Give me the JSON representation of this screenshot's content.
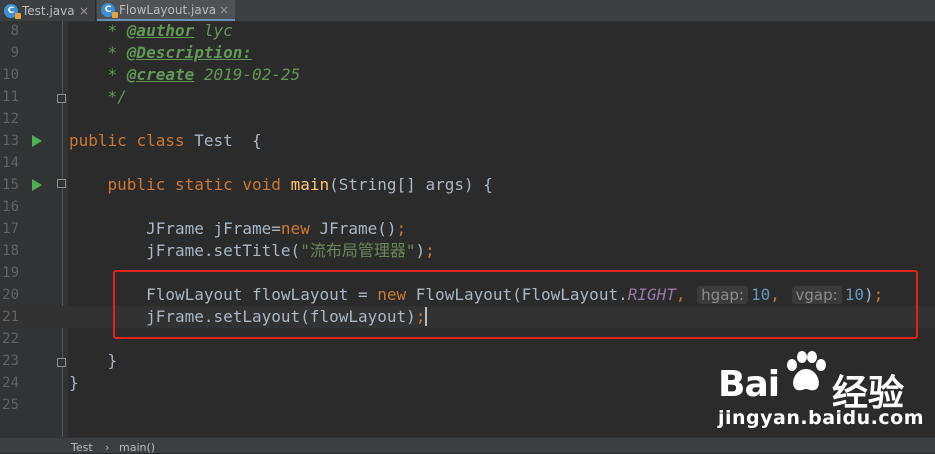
{
  "tabs": [
    {
      "label": "Test.java",
      "active": false
    },
    {
      "label": "FlowLayout.java",
      "active": true
    }
  ],
  "tab_close_glyph": "×",
  "file_icon_letter": "C",
  "editor": {
    "line_numbers": [
      "8",
      "9",
      "10",
      "11",
      "12",
      "13",
      "14",
      "15",
      "16",
      "17",
      "18",
      "19",
      "20",
      "21",
      "22",
      "23",
      "24",
      "25"
    ],
    "line8": {
      "star": "* ",
      "tag": "@author",
      "rest": " lyc"
    },
    "line9": {
      "star": "* ",
      "tag": "@Description:"
    },
    "line10": {
      "star": "* ",
      "tag": "@create",
      "rest": " 2019-02-25"
    },
    "line11": {
      "text": "*/"
    },
    "line13": {
      "kw1": "public",
      "kw2": "class",
      "name": " Test  {"
    },
    "line15": {
      "kw1": "public",
      "kw2": "static",
      "kw3": "void",
      "method": "main",
      "params": "(String[] args) {"
    },
    "line17": {
      "a": "JFrame jFrame=",
      "kw": "new",
      "b": " JFrame()",
      "semi": ";"
    },
    "line18": {
      "a": "jFrame.setTitle(",
      "str": "\"流布局管理器\"",
      "b": ")",
      "semi": ";"
    },
    "line20": {
      "a": "FlowLayout flowLayout = ",
      "kw": "new",
      "b": " FlowLayout(FlowLayout.",
      "static_field": "RIGHT",
      "comma1": ",",
      "hint1": "hgap:",
      "num1": "10",
      "comma2": ",",
      "hint2": "vgap:",
      "num2": "10",
      "end": ")",
      "semi": ";"
    },
    "line21": {
      "a": "jFrame.setLayout(flowLayout)",
      "semi": ";"
    },
    "line23": {
      "text": "}"
    },
    "line24": {
      "text": "}"
    }
  },
  "breadcrumb": {
    "items": [
      "Test",
      "main()"
    ],
    "separator": "›"
  },
  "watermark": {
    "brand_left": "Bai",
    "brand_right": "经验",
    "url": "jingyan.baidu.com"
  },
  "colors": {
    "background": "#2b2b2b",
    "keyword": "#cc7832",
    "method": "#ffc66d",
    "string": "#6a8759",
    "number": "#6897bb",
    "highlight_box": "#e0241b"
  }
}
